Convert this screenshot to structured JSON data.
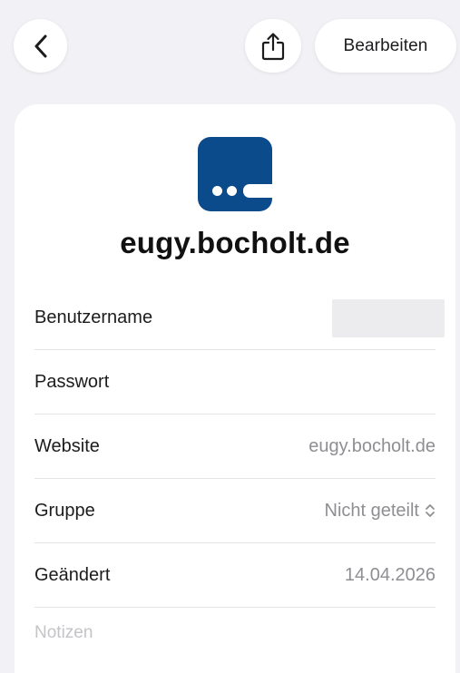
{
  "nav": {
    "back_icon": "chevron-left-icon",
    "share_icon": "share-icon",
    "edit_label": "Bearbeiten"
  },
  "header": {
    "site_title": "eugy.bocholt.de",
    "app_icon": "eugy-logo-icon",
    "app_icon_color": "#0b4a8b"
  },
  "fields": {
    "username": {
      "label": "Benutzername",
      "value": ""
    },
    "password": {
      "label": "Passwort",
      "value": ""
    },
    "website": {
      "label": "Website",
      "value": "eugy.bocholt.de"
    },
    "group": {
      "label": "Gruppe",
      "value": "Nicht geteilt",
      "icon": "chevron-up-down-icon"
    },
    "changed": {
      "label": "Geändert",
      "value": "14.04.2026"
    }
  },
  "notes": {
    "placeholder": "Notizen"
  }
}
